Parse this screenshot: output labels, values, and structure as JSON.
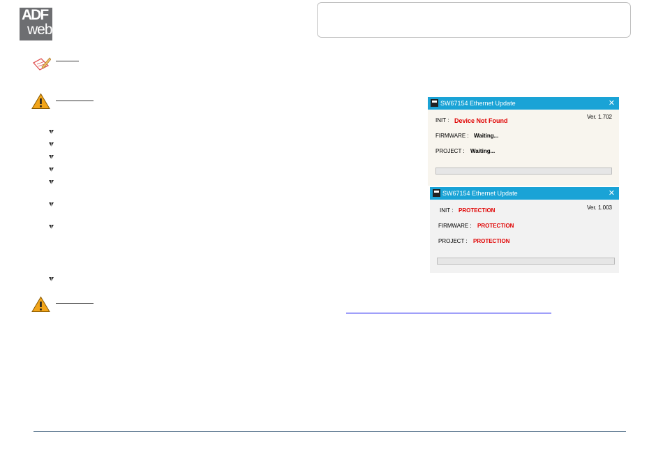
{
  "logo": {
    "line1": "ADF",
    "line2": "web"
  },
  "windows": [
    {
      "title": "SW67154 Ethernet Update",
      "close": "✕",
      "version": "Ver. 1.702",
      "init_label": "INIT :",
      "init_value": "Device Not Found",
      "firmware_label": "FIRMWARE :",
      "firmware_value": "Waiting...",
      "project_label": "PROJECT :",
      "project_value": "Waiting..."
    },
    {
      "title": "SW67154 Ethernet Update",
      "close": "✕",
      "version": "Ver. 1.003",
      "init_label": "INIT :",
      "init_value": "PROTECTION",
      "firmware_label": "FIRMWARE :",
      "firmware_value": "PROTECTION",
      "project_label": "PROJECT :",
      "project_value": "PROTECTION"
    }
  ],
  "colors": {
    "titlebar": "#1aa3d6",
    "error_text": "#e00000",
    "warning_icon": "#f2a51a",
    "footer_rule": "#2b4f6e"
  },
  "icons": {
    "note": "pencil-note-icon",
    "warning_1": "warning-triangle-icon",
    "warning_2": "warning-triangle-icon",
    "bullet": "diamond-bullet-icon"
  }
}
